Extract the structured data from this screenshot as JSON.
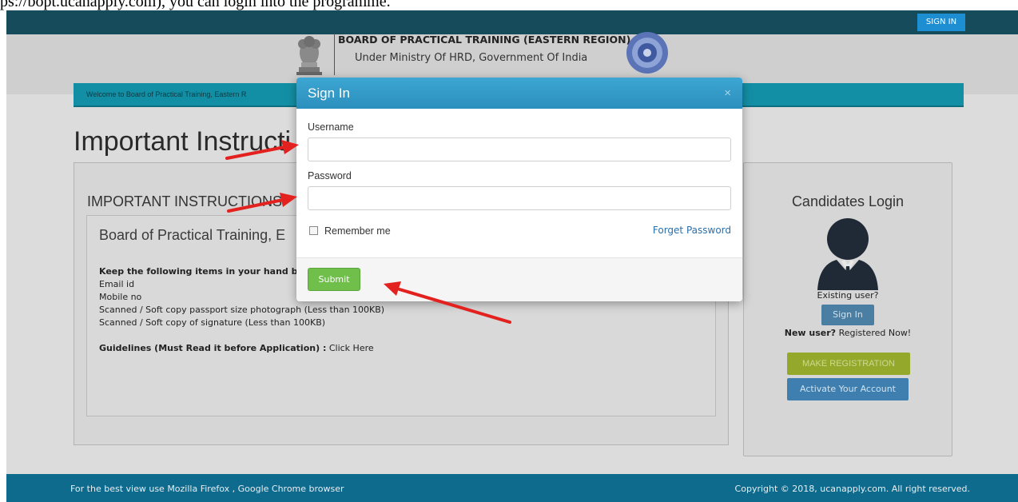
{
  "caption": "ps://bopt.ucanapply.com), you can login into the programme.",
  "topbar": {
    "sign_in_label": "SIGN IN"
  },
  "header": {
    "org_title": "BOARD OF PRACTICAL TRAINING (EASTERN REGION)",
    "org_subtitle": "Under Ministry Of HRD, Government Of India"
  },
  "welcome_text": "Welcome to Board of Practical Training, Eastern R",
  "page_title": "Important Instructi",
  "instructions": {
    "heading": "IMPORTANT INSTRUCTIONS",
    "inner_title": "Board of Practical Training, E",
    "keep_items": "Keep the following items in your hand b",
    "items": [
      "Email id",
      "Mobile no",
      "Scanned / Soft copy passport size photograph (Less than 100KB)",
      "Scanned / Soft copy of signature (Less than 100KB)"
    ],
    "guidelines_label": "Guidelines (Must Read it before Application) :",
    "guidelines_link": "Click Here"
  },
  "candidates": {
    "title": "Candidates Login",
    "existing_user": "Existing user?",
    "sign_in_button": "Sign In",
    "new_user_bold": "New user?",
    "new_user_text": "Registered Now!",
    "make_registration": "MAKE REGISTRATION",
    "activate_account": "Activate Your Account"
  },
  "modal": {
    "title": "Sign In",
    "close": "×",
    "username_label": "Username",
    "username_value": "",
    "password_label": "Password",
    "password_value": "",
    "remember_me": "Remember me",
    "forget_password": "Forget Password",
    "submit": "Submit"
  },
  "footer": {
    "left": "For the best view use Mozilla Firefox , Google Chrome browser",
    "right": "Copyright © 2018, ucanapply.com. All right reserved."
  },
  "colors": {
    "topbar": "#154b5b",
    "modal_header": "#2b8fbd",
    "submit": "#6fbf4a",
    "annotation_arrow": "#e3211f",
    "footer": "#0f6b8d"
  }
}
